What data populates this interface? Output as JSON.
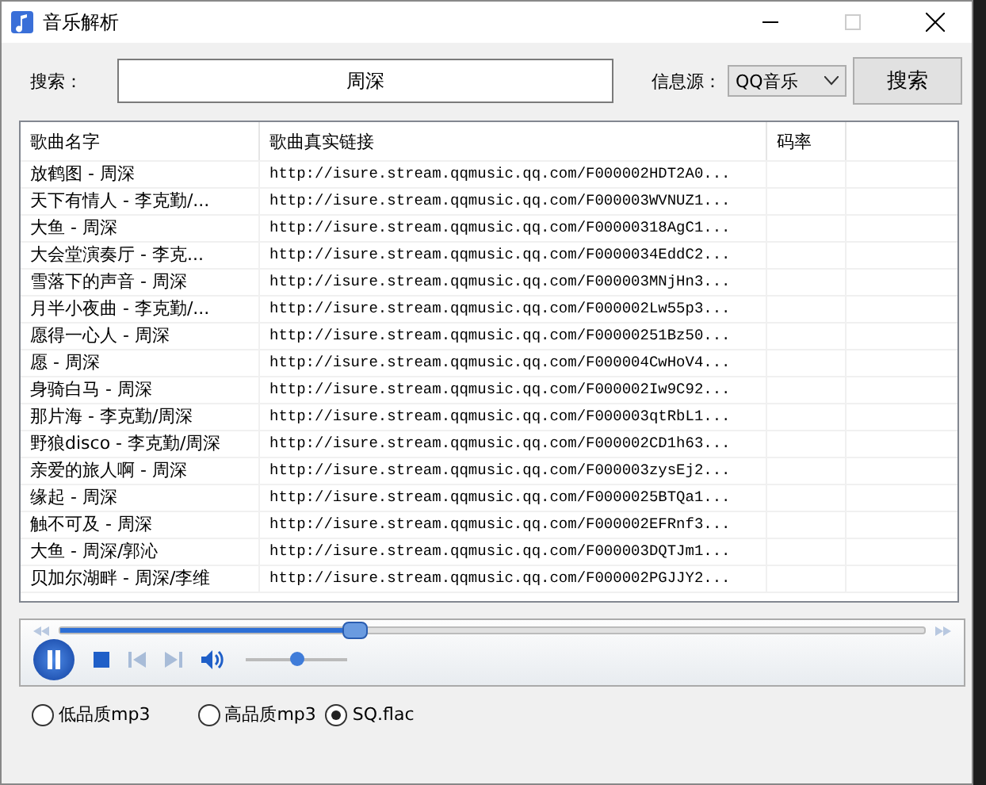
{
  "window": {
    "title": "音乐解析"
  },
  "search": {
    "label": "搜索：",
    "value": "周深",
    "source_label": "信息源：",
    "source": "QQ音乐",
    "button": "搜索"
  },
  "table": {
    "columns": [
      "歌曲名字",
      "歌曲真实链接",
      "码率"
    ],
    "rows": [
      {
        "name": "放鹤图 - 周深",
        "link": "http://isure.stream.qqmusic.qq.com/F000002HDT2A0..."
      },
      {
        "name": "天下有情人 - 李克勤/...",
        "link": "http://isure.stream.qqmusic.qq.com/F000003WVNUZ1..."
      },
      {
        "name": "大鱼 - 周深",
        "link": "http://isure.stream.qqmusic.qq.com/F00000318AgC1..."
      },
      {
        "name": "大会堂演奏厅 - 李克...",
        "link": "http://isure.stream.qqmusic.qq.com/F0000034EddC2..."
      },
      {
        "name": "雪落下的声音 - 周深",
        "link": "http://isure.stream.qqmusic.qq.com/F000003MNjHn3..."
      },
      {
        "name": "月半小夜曲 - 李克勤/...",
        "link": "http://isure.stream.qqmusic.qq.com/F000002Lw55p3..."
      },
      {
        "name": "愿得一心人 - 周深",
        "link": "http://isure.stream.qqmusic.qq.com/F00000251Bz50..."
      },
      {
        "name": "愿 - 周深",
        "link": "http://isure.stream.qqmusic.qq.com/F000004CwHoV4..."
      },
      {
        "name": "身骑白马 - 周深",
        "link": "http://isure.stream.qqmusic.qq.com/F000002Iw9C92..."
      },
      {
        "name": "那片海 - 李克勤/周深",
        "link": "http://isure.stream.qqmusic.qq.com/F000003qtRbL1..."
      },
      {
        "name": "野狼disco - 李克勤/周深",
        "link": "http://isure.stream.qqmusic.qq.com/F000002CD1h63..."
      },
      {
        "name": "亲爱的旅人啊 - 周深",
        "link": "http://isure.stream.qqmusic.qq.com/F000003zysEj2..."
      },
      {
        "name": "缘起 - 周深",
        "link": "http://isure.stream.qqmusic.qq.com/F0000025BTQa1..."
      },
      {
        "name": "触不可及 - 周深",
        "link": "http://isure.stream.qqmusic.qq.com/F000002EFRnf3..."
      },
      {
        "name": "大鱼 - 周深/郭沁",
        "link": "http://isure.stream.qqmusic.qq.com/F000003DQTJm1..."
      },
      {
        "name": "贝加尔湖畔 - 周深/李维",
        "link": "http://isure.stream.qqmusic.qq.com/F000002PGJJY2..."
      }
    ]
  },
  "player": {
    "position": {
      "level": 0.34
    },
    "volume": {
      "level": 0.5
    },
    "playing": true
  },
  "quality": [
    {
      "label": "低品质mp3",
      "selected": false
    },
    {
      "label": "高品质mp3",
      "selected": false
    },
    {
      "label": "SQ.flac",
      "selected": true
    }
  ]
}
